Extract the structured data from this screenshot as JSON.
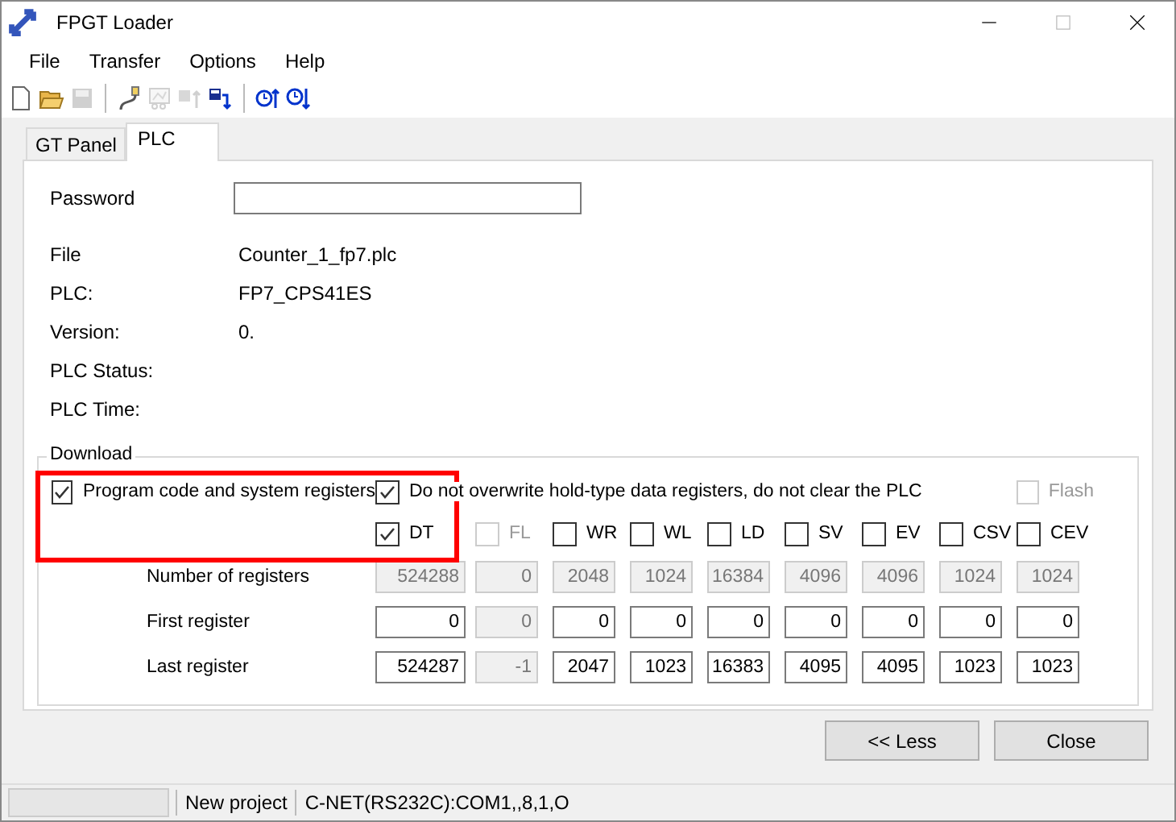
{
  "window": {
    "title": "FPGT Loader"
  },
  "menu": [
    "File",
    "Transfer",
    "Options",
    "Help"
  ],
  "toolbar": [
    {
      "kind": "new",
      "disabled": false
    },
    {
      "kind": "open",
      "disabled": false
    },
    {
      "kind": "save",
      "disabled": true
    },
    {
      "kind": "separator"
    },
    {
      "kind": "connect",
      "disabled": false
    },
    {
      "kind": "form",
      "disabled": true
    },
    {
      "kind": "upload",
      "disabled": true
    },
    {
      "kind": "download",
      "disabled": false
    },
    {
      "kind": "separator"
    },
    {
      "kind": "clock-up",
      "disabled": false
    },
    {
      "kind": "clock-down",
      "disabled": false
    }
  ],
  "tabs": [
    {
      "label": "GT Panel",
      "selected": false
    },
    {
      "label": "PLC",
      "selected": true
    }
  ],
  "password": {
    "label": "Password"
  },
  "info": [
    {
      "label": "File",
      "value": "Counter_1_fp7.plc"
    },
    {
      "label": "PLC:",
      "value": "FP7_CPS41ES"
    },
    {
      "label": "Version:",
      "value": "0."
    },
    {
      "label": "PLC Status:"
    },
    {
      "label": "PLC Time:"
    }
  ],
  "download": {
    "title": "Download",
    "program": {
      "label": "Program code and system registers",
      "checked": true,
      "disabled": false
    },
    "no_overwrite": {
      "label": "Do not overwrite hold-type data registers, do not clear the PLC",
      "checked": true,
      "disabled": false
    },
    "flash": {
      "label": "Flash",
      "checked": false,
      "disabled": true
    },
    "row_labels": [
      "Number of registers",
      "First register",
      "Last register"
    ],
    "registers": [
      {
        "name": "DT",
        "checked": true,
        "disabled": false,
        "count": "524288",
        "first": "0",
        "last": "524287"
      },
      {
        "name": "FL",
        "checked": false,
        "disabled": true,
        "count": "0",
        "first": "0",
        "last": "-1"
      },
      {
        "name": "WR",
        "checked": false,
        "disabled": false,
        "count": "2048",
        "first": "0",
        "last": "2047"
      },
      {
        "name": "WL",
        "checked": false,
        "disabled": false,
        "count": "1024",
        "first": "0",
        "last": "1023"
      },
      {
        "name": "LD",
        "checked": false,
        "disabled": false,
        "count": "16384",
        "first": "0",
        "last": "16383"
      },
      {
        "name": "SV",
        "checked": false,
        "disabled": false,
        "count": "4096",
        "first": "0",
        "last": "4095"
      },
      {
        "name": "EV",
        "checked": false,
        "disabled": false,
        "count": "4096",
        "first": "0",
        "last": "4095"
      },
      {
        "name": "CSV",
        "checked": false,
        "disabled": false,
        "count": "1024",
        "first": "0",
        "last": "1023"
      },
      {
        "name": "CEV",
        "checked": false,
        "disabled": false,
        "count": "1024",
        "first": "0",
        "last": "1023"
      }
    ]
  },
  "highlight": {
    "color": "#ff0000"
  },
  "buttons": [
    "<< Less",
    "Close"
  ],
  "status_bar": [
    "New project",
    "C-NET(RS232C):COM1,,8,1,O"
  ]
}
